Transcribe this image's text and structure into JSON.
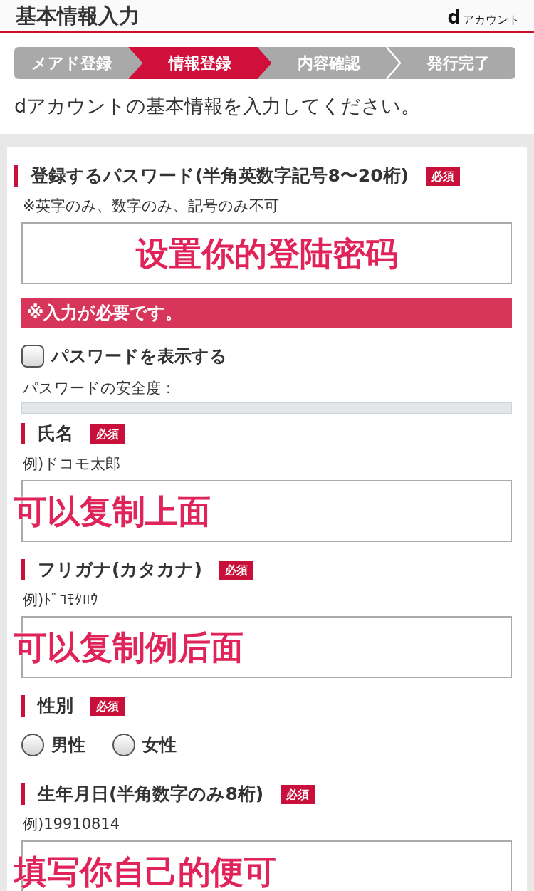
{
  "header": {
    "title": "基本情報入力",
    "logo_mark": "d",
    "logo_text": "アカウント"
  },
  "steps": [
    {
      "label": "メアド登録",
      "selected": false
    },
    {
      "label": "情報登録",
      "selected": true
    },
    {
      "label": "内容確認",
      "selected": false
    },
    {
      "label": "発行完了",
      "selected": false
    }
  ],
  "intro": "dアカウントの基本情報を入力してください。",
  "form": {
    "fields": [
      {
        "kind": "password",
        "label": "登録するパスワード(半角英数字記号8〜20桁)",
        "badge": "必須",
        "note": "※英字のみ、数字のみ、記号のみ不可",
        "annotation": "设置你的登陆密码",
        "error": "※入力が必要です。",
        "show_password": {
          "label": "パスワードを表示する",
          "checked": false
        },
        "strength": {
          "label": "パスワードの安全度："
        }
      },
      {
        "kind": "text",
        "label": "氏名",
        "badge": "必須",
        "note": "例)ドコモ太郎",
        "annotation": "可以复制上面"
      },
      {
        "kind": "text",
        "label": "フリガナ(カタカナ)",
        "badge": "必須",
        "note": "例)ﾄﾞｺﾓﾀﾛｳ",
        "annotation": "可以复制例后面"
      },
      {
        "kind": "radio",
        "label": "性別",
        "badge": "必須",
        "options": [
          {
            "label": "男性",
            "selected": false
          },
          {
            "label": "女性",
            "selected": false
          }
        ]
      },
      {
        "kind": "text",
        "label": "生年月日(半角数字のみ8桁)",
        "badge": "必須",
        "note": "例)19910814",
        "annotation": "填写你自己的便可"
      }
    ]
  }
}
